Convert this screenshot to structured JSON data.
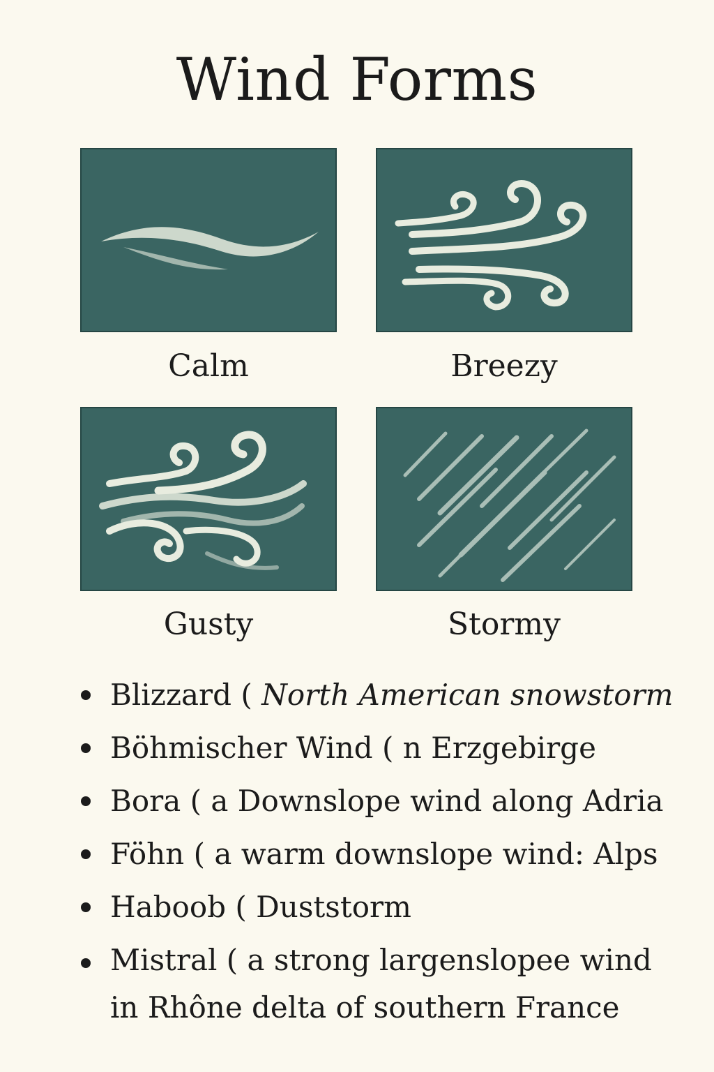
{
  "title": "Wind Forms",
  "colors": {
    "background": "#fbf9ef",
    "tile": "#3a6562",
    "tile_border": "#254644",
    "stroke": "#e8ecdf"
  },
  "tiles": [
    {
      "label": "Calm",
      "icon": "calm-wind-icon"
    },
    {
      "label": "Breezy",
      "icon": "breezy-wind-icon"
    },
    {
      "label": "Gusty",
      "icon": "gusty-wind-icon"
    },
    {
      "label": "Stormy",
      "icon": "stormy-wind-icon"
    }
  ],
  "winds": [
    {
      "name": "Blizzard",
      "paren": "(",
      "desc": "North American snowstorm"
    },
    {
      "name": "Böhmischer Wind",
      "paren": "(",
      "desc": "n Erzgebirge"
    },
    {
      "name": "Bora",
      "paren": "(",
      "desc": "a Downslope wind along Adria"
    },
    {
      "name": "Föhn",
      "paren": "(",
      "desc": "a warm downslope wind: Alps"
    },
    {
      "name": "Haboob",
      "paren": "(",
      "desc": "Duststorm"
    },
    {
      "name": "Mistral",
      "paren": "(",
      "desc": "a strong largenslopee wind",
      "desc2": "in Rhône delta of southern France"
    }
  ]
}
